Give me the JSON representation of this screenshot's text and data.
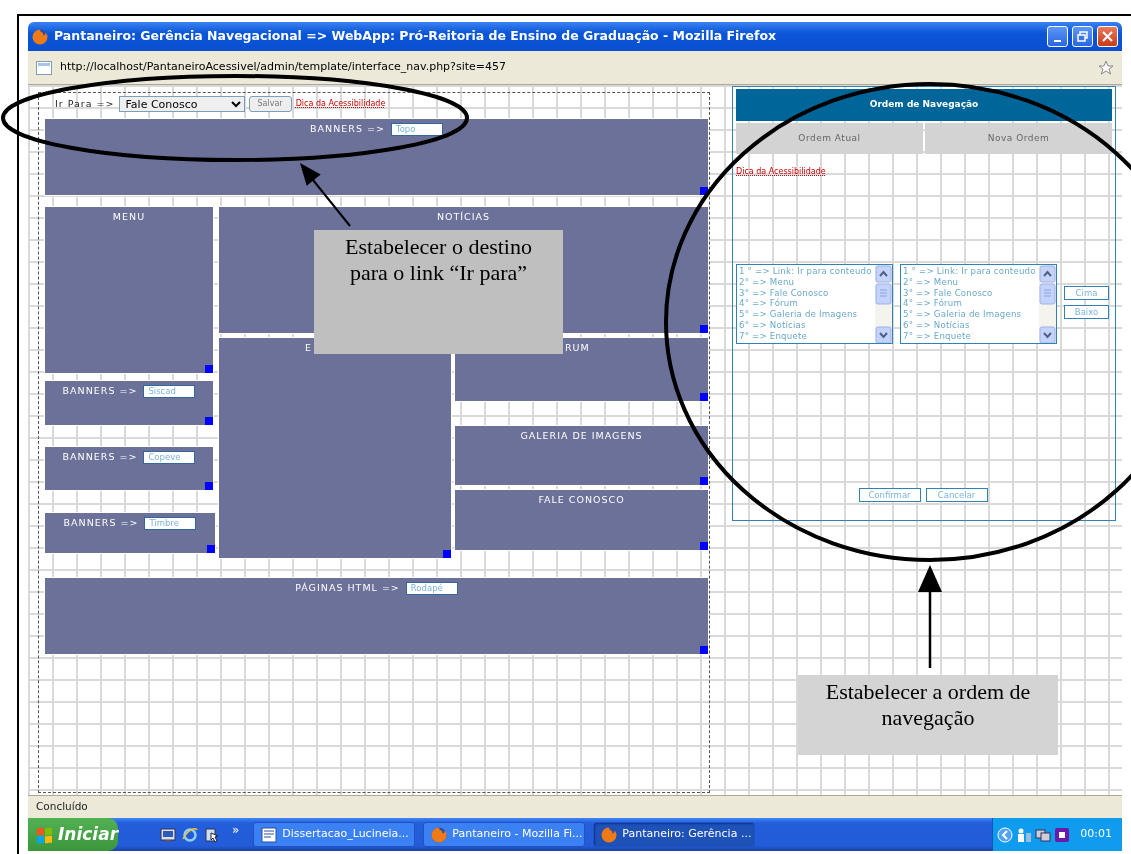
{
  "window": {
    "title": "Pantaneiro: Gerência Navegacional => WebApp: Pró-Reitoria de Ensino de Graduação - Mozilla Firefox"
  },
  "address_bar": {
    "url": "http://localhost/PantaneiroAcessivel/admin/template/interface_nav.php?site=457"
  },
  "layout_editor": {
    "goto_label": "Ir Para =>",
    "goto_value": "Fale Conosco",
    "save_button": "Salvar",
    "tip_link": "Dica da Acessibilidade",
    "blocks": [
      {
        "title": "BANNERS =>",
        "field": "Topo"
      },
      {
        "title": "MENU"
      },
      {
        "title": "NOTÍCIAS"
      },
      {
        "title": "BANNERS =>",
        "field": "Siscad"
      },
      {
        "title": "BANNERS =>",
        "field": "Copeve"
      },
      {
        "title": "BANNERS =>",
        "field": "Timbre"
      },
      {
        "title": "E"
      },
      {
        "title": "RUM"
      },
      {
        "title": "GALERIA DE IMAGENS"
      },
      {
        "title": "FALE CONOSCO"
      },
      {
        "title": "PÁGINAS HTML =>",
        "field": "Rodapé"
      }
    ]
  },
  "navigation_panel": {
    "title": "Ordem de Navegação",
    "columns": [
      "Ordem Atual",
      "Nova Ordem"
    ],
    "tip_link": "Dica da Acessibilidade",
    "current_order": [
      {
        "label": "1 ° => Link: Ir para conteudo",
        "selected": false
      },
      {
        "label": "2° => Menu",
        "selected": false
      },
      {
        "label": "3° => Fale Conosco",
        "selected": false
      },
      {
        "label": "4° => Fórum",
        "selected": false
      },
      {
        "label": "5° => Galeria de Imagens",
        "selected": false
      },
      {
        "label": "6° => Notícias",
        "selected": false
      },
      {
        "label": "7° => Enquete",
        "selected": false
      }
    ],
    "new_order": [
      {
        "label": "1 ° => Link: Ir para conteudo",
        "selected": false
      },
      {
        "label": "2° => Menu",
        "selected": false
      },
      {
        "label": "3° => Fale Conosco",
        "selected": false
      },
      {
        "label": "4° => Fórum",
        "selected": false
      },
      {
        "label": "5° => Galeria de Imagens",
        "selected": false
      },
      {
        "label": "6° => Notícias",
        "selected": false
      },
      {
        "label": "7° => Enquete",
        "selected": false
      }
    ],
    "move_buttons": [
      "Cima",
      "Baixo"
    ],
    "buttons": [
      "Confirmar",
      "Cancelar"
    ]
  },
  "annotations": [
    {
      "text": "Estabelecer o destino para o link “Ir para”"
    },
    {
      "text": "Estabelecer a ordem de navegação"
    }
  ],
  "status_bar": {
    "text": "Concluído"
  },
  "taskbar": {
    "start": "Iniciar",
    "overflow": "»",
    "tasks": [
      {
        "label": "Dissertacao_Lucineia...",
        "kind": "document",
        "selected": false
      },
      {
        "label": "Pantaneiro - Mozilla Fi...",
        "kind": "browser",
        "selected": false
      },
      {
        "label": "Pantaneiro: Gerência ...",
        "kind": "browser",
        "selected": true
      }
    ],
    "clock": "00:01"
  }
}
